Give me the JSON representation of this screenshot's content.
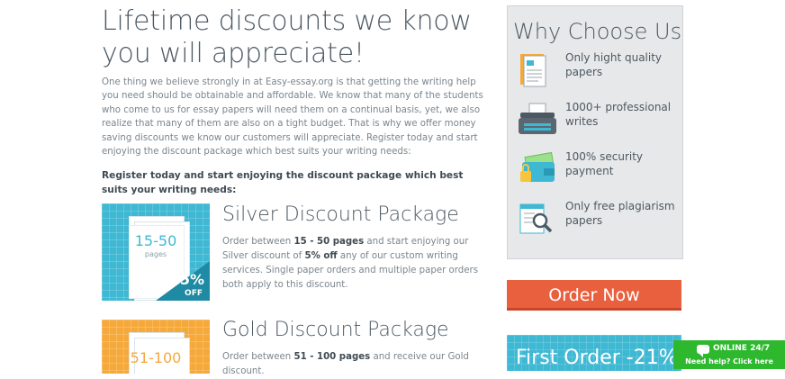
{
  "main": {
    "headline": "Lifetime discounts we know you will appreciate!",
    "intro": "One thing we believe strongly in at Easy-essay.org is that getting the writing help you need should be obtainable and affordable. We know that many of the students who come to us for essay papers will need them on a continual basis, yet, we also realize that many of them are also on a tight budget. That is why we offer money saving discounts we know our customers will appreciate. Register today and start enjoying the discount package which best suits your writing needs:",
    "register_text": "Register today and start enjoying the discount package which best suits your writing needs:"
  },
  "packages": [
    {
      "title": "Silver Discount Package",
      "thumb_range": "15-50",
      "thumb_unit": "pages",
      "thumb_percent": "5%",
      "thumb_off": "OFF",
      "desc_1": "Order between ",
      "desc_bold_1": "15 - 50 pages",
      "desc_2": " and start enjoying our Silver discount of ",
      "desc_bold_2": "5% off",
      "desc_3": " any of our custom writing services. Single paper orders and multiple paper orders both apply to this discount.",
      "color": "#3fb8d3"
    },
    {
      "title": "Gold Discount Package",
      "thumb_range": "51-100",
      "desc_1": "Order between ",
      "desc_bold_1": "51 - 100 pages",
      "desc_2": " and receive our Gold discount.",
      "color": "#f6a93b"
    }
  ],
  "sidebar": {
    "why_title": "Why Choose Us",
    "items": [
      {
        "label": "Only hight quality papers",
        "icon": "document-icon"
      },
      {
        "label": "1000+ professional writes",
        "icon": "typewriter-icon"
      },
      {
        "label": "100% security payment",
        "icon": "wallet-lock-icon"
      },
      {
        "label": "Only free plagiarism papers",
        "icon": "plagiarism-check-icon"
      }
    ],
    "order_button": "Order Now",
    "first_order": "First Order -21%"
  },
  "chat": {
    "status": "ONLINE 24/7",
    "help": "Need help? Click here"
  },
  "colors": {
    "accent_blue": "#3fb8d3",
    "accent_orange": "#f6a93b",
    "order_red": "#e9603f",
    "chat_green": "#2eb82e"
  }
}
